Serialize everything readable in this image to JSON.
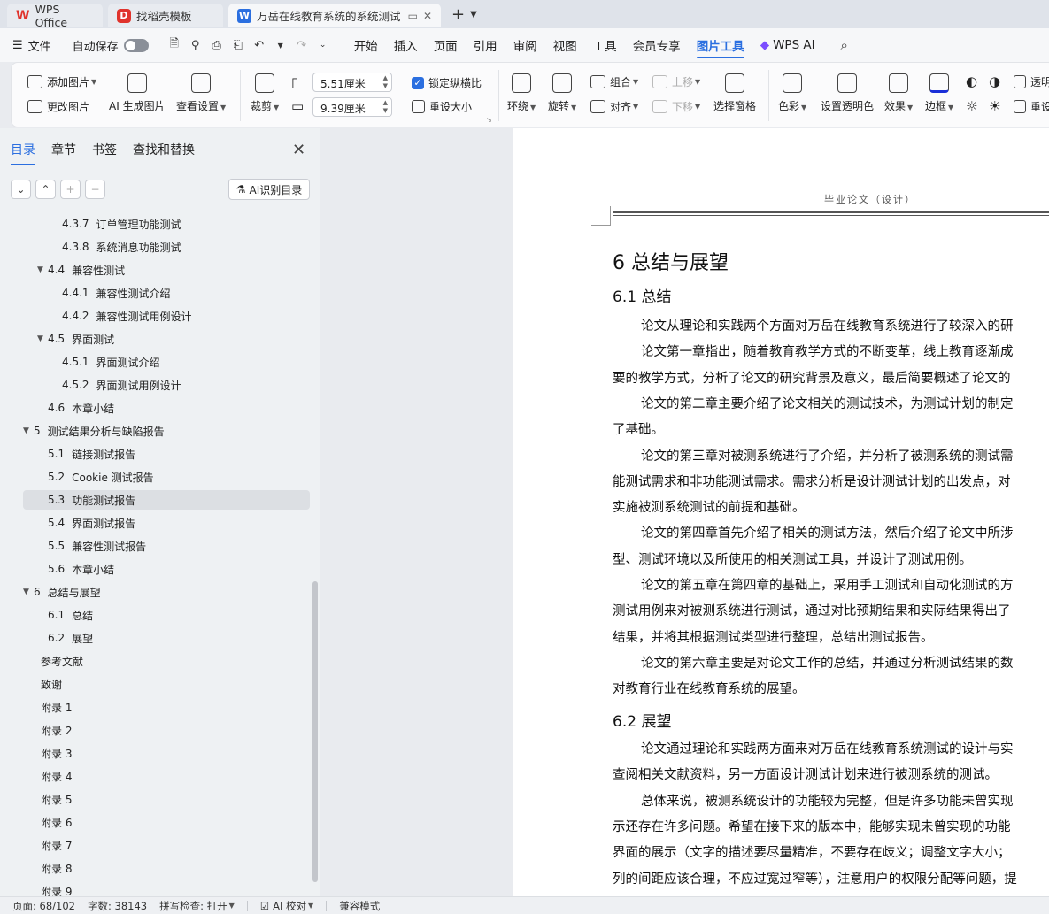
{
  "tabs": {
    "wps": "WPS Office",
    "template": "找稻壳模板",
    "document": "万岳在线教育系统的系统测试"
  },
  "menu": {
    "file": "文件",
    "autosave": "自动保存",
    "ribbon_tabs": [
      "开始",
      "插入",
      "页面",
      "引用",
      "审阅",
      "视图",
      "工具",
      "会员专享",
      "图片工具",
      "WPS AI"
    ],
    "active_tab": "图片工具"
  },
  "ribbon": {
    "add_image": "添加图片",
    "change_image": "更改图片",
    "ai_generate": "AI 生成图片",
    "view_settings": "查看设置",
    "crop": "裁剪",
    "width": "5.51厘米",
    "height": "9.39厘米",
    "lock_ratio": "锁定纵横比",
    "reset_size": "重设大小",
    "wrap": "环绕",
    "rotate": "旋转",
    "group": "组合",
    "align": "对齐",
    "move_up": "上移",
    "move_down": "下移",
    "selection_pane": "选择窗格",
    "color": "色彩",
    "transparency": "设置透明色",
    "effects": "效果",
    "border": "边框",
    "transparent": "透明",
    "reset": "重设"
  },
  "nav": {
    "tabs": [
      "目录",
      "章节",
      "书签",
      "查找和替换"
    ],
    "ai_toc": "AI识别目录",
    "items": [
      {
        "num": "4.3.7",
        "text": "订单管理功能测试",
        "level": 3
      },
      {
        "num": "4.3.8",
        "text": "系统消息功能测试",
        "level": 3
      },
      {
        "num": "4.4",
        "text": "兼容性测试",
        "level": 2,
        "expanded": true
      },
      {
        "num": "4.4.1",
        "text": "兼容性测试介绍",
        "level": 3
      },
      {
        "num": "4.4.2",
        "text": "兼容性测试用例设计",
        "level": 3
      },
      {
        "num": "4.5",
        "text": "界面测试",
        "level": 2,
        "expanded": true
      },
      {
        "num": "4.5.1",
        "text": "界面测试介绍",
        "level": 3
      },
      {
        "num": "4.5.2",
        "text": "界面测试用例设计",
        "level": 3
      },
      {
        "num": "4.6",
        "text": "本章小结",
        "level": 2
      },
      {
        "num": "5",
        "text": "测试结果分析与缺陷报告",
        "level": 1,
        "expanded": true
      },
      {
        "num": "5.1",
        "text": "链接测试报告",
        "level": 2
      },
      {
        "num": "5.2",
        "text": "Cookie 测试报告",
        "level": 2
      },
      {
        "num": "5.3",
        "text": "功能测试报告",
        "level": 2,
        "selected": true
      },
      {
        "num": "5.4",
        "text": "界面测试报告",
        "level": 2
      },
      {
        "num": "5.5",
        "text": "兼容性测试报告",
        "level": 2
      },
      {
        "num": "5.6",
        "text": "本章小结",
        "level": 2
      },
      {
        "num": "6",
        "text": "总结与展望",
        "level": 1,
        "expanded": true
      },
      {
        "num": "6.1",
        "text": "总结",
        "level": 2
      },
      {
        "num": "6.2",
        "text": "展望",
        "level": 2
      },
      {
        "num": "",
        "text": "参考文献",
        "level": 1
      },
      {
        "num": "",
        "text": "致谢",
        "level": 1
      },
      {
        "num": "",
        "text": "附录 1",
        "level": 1
      },
      {
        "num": "",
        "text": "附录 2",
        "level": 1
      },
      {
        "num": "",
        "text": "附录 3",
        "level": 1
      },
      {
        "num": "",
        "text": "附录 4",
        "level": 1
      },
      {
        "num": "",
        "text": "附录 5",
        "level": 1
      },
      {
        "num": "",
        "text": "附录 6",
        "level": 1
      },
      {
        "num": "",
        "text": "附录 7",
        "level": 1
      },
      {
        "num": "",
        "text": "附录 8",
        "level": 1
      },
      {
        "num": "",
        "text": "附录 9",
        "level": 1
      }
    ]
  },
  "doc": {
    "header": "毕业论文（设计）",
    "chapter_title": "6   总结与展望",
    "section1": "6.1   总结",
    "section2": "6.2   展望",
    "lines1": [
      {
        "text": "论文从理论和实践两个方面对万岳在线教育系统进行了较深入的研",
        "indent": true
      },
      {
        "text": "论文第一章指出，随着教育教学方式的不断变革，线上教育逐渐成",
        "indent": true
      },
      {
        "text": "要的教学方式，分析了论文的研究背景及意义，最后简要概述了论文的",
        "indent": false
      },
      {
        "text": "论文的第二章主要介绍了论文相关的测试技术，为测试计划的制定",
        "indent": true
      },
      {
        "text": "了基础。",
        "indent": false
      },
      {
        "text": "论文的第三章对被测系统进行了介绍，并分析了被测系统的测试需",
        "indent": true
      },
      {
        "text": "能测试需求和非功能测试需求。需求分析是设计测试计划的出发点，对",
        "indent": false
      },
      {
        "text": "实施被测系统测试的前提和基础。",
        "indent": false
      },
      {
        "text": "论文的第四章首先介绍了相关的测试方法，然后介绍了论文中所涉",
        "indent": true
      },
      {
        "text": "型、测试环境以及所使用的相关测试工具，并设计了测试用例。",
        "indent": false
      },
      {
        "text": "论文的第五章在第四章的基础上，采用手工测试和自动化测试的方",
        "indent": true
      },
      {
        "text": "测试用例来对被测系统进行测试，通过对比预期结果和实际结果得出了",
        "indent": false
      },
      {
        "text": "结果，并将其根据测试类型进行整理，总结出测试报告。",
        "indent": false
      },
      {
        "text": "论文的第六章主要是对论文工作的总结，并通过分析测试结果的数",
        "indent": true
      },
      {
        "text": "对教育行业在线教育系统的展望。",
        "indent": false
      }
    ],
    "lines2": [
      {
        "text": "论文通过理论和实践两方面来对万岳在线教育系统测试的设计与实",
        "indent": true
      },
      {
        "text": "查阅相关文献资料，另一方面设计测试计划来进行被测系统的测试。",
        "indent": false
      },
      {
        "text": "总体来说，被测系统设计的功能较为完整，但是许多功能未曾实现",
        "indent": true
      },
      {
        "text": "示还存在许多问题。希望在接下来的版本中，能够实现未曾实现的功能",
        "indent": false
      },
      {
        "text": "界面的展示（文字的描述要尽量精准，不要存在歧义；调整文字大小；",
        "indent": false
      },
      {
        "text": "列的间距应该合理，不应过宽过窄等），注意用户的权限分配等问题，提",
        "indent": false
      }
    ]
  },
  "status": {
    "page": "页面: 68/102",
    "words": "字数: 38143",
    "spell": "拼写检查: 打开",
    "ai_check": "AI 校对",
    "compat": "兼容模式"
  }
}
